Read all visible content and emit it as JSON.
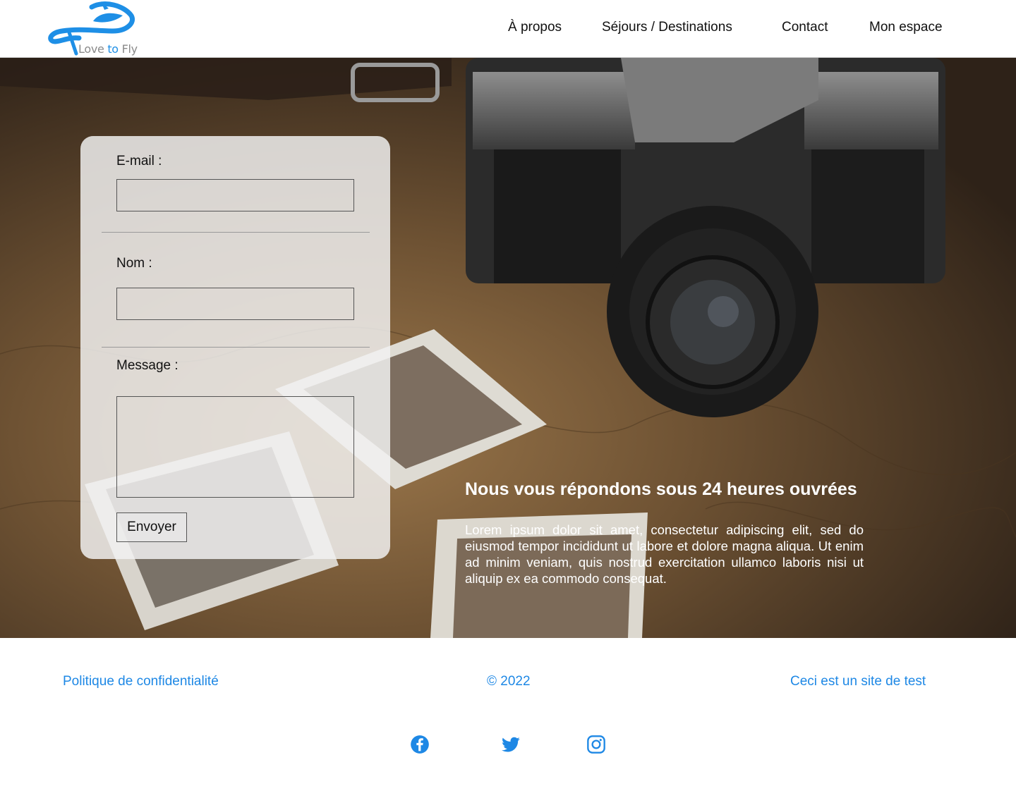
{
  "header": {
    "logo_text_before": "Love ",
    "logo_text_to": "to",
    "logo_text_after": " Fly",
    "nav": [
      {
        "label": "À propos"
      },
      {
        "label": "Séjours / Destinations"
      },
      {
        "label": "Contact"
      },
      {
        "label": "Mon espace"
      }
    ]
  },
  "form": {
    "email_label": "E-mail :",
    "email_value": "",
    "name_label": "Nom :",
    "name_value": "",
    "message_label": "Message :",
    "message_value": "",
    "submit_label": "Envoyer"
  },
  "hero": {
    "title": "Nous vous répondons sous 24 heures ouvrées",
    "body": "Lorem ipsum dolor sit amet, consectetur adipiscing elit, sed do eiusmod tempor incididunt ut labore et dolore magna aliqua. Ut enim ad minim veniam, quis nostrud exercitation ullamco laboris nisi ut aliquip ex ea commodo consequat."
  },
  "footer": {
    "privacy": "Politique de confidentialité",
    "copyright": "© 2022",
    "note": "Ceci est un site de test",
    "social": [
      "facebook-icon",
      "twitter-icon",
      "instagram-icon"
    ]
  },
  "colors": {
    "accent": "#1e88e5",
    "logo_blue": "#1e8fe6"
  }
}
